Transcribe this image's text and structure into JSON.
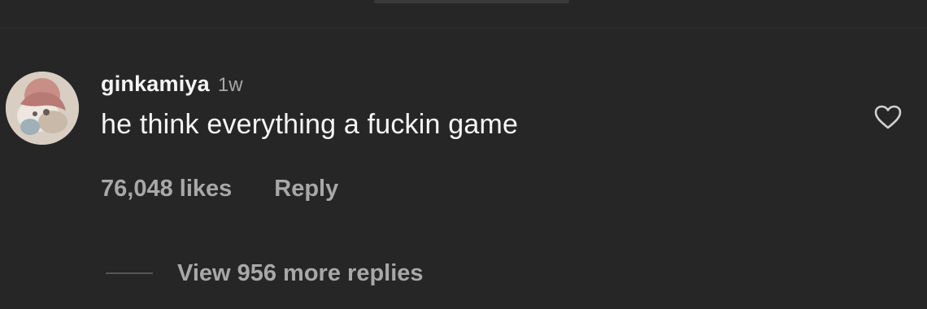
{
  "comment": {
    "username": "ginkamiya",
    "time": "1w",
    "text": "he think everything a fuckin game",
    "likes": "76,048 likes",
    "reply_label": "Reply",
    "avatar_icon": "user-avatar",
    "like_icon": "heart-outline-icon"
  },
  "replies": {
    "view_label": "View 956 more replies"
  },
  "colors": {
    "background": "#262626",
    "primary_text": "#f5f5f5",
    "secondary_text": "#a8a8a8"
  }
}
